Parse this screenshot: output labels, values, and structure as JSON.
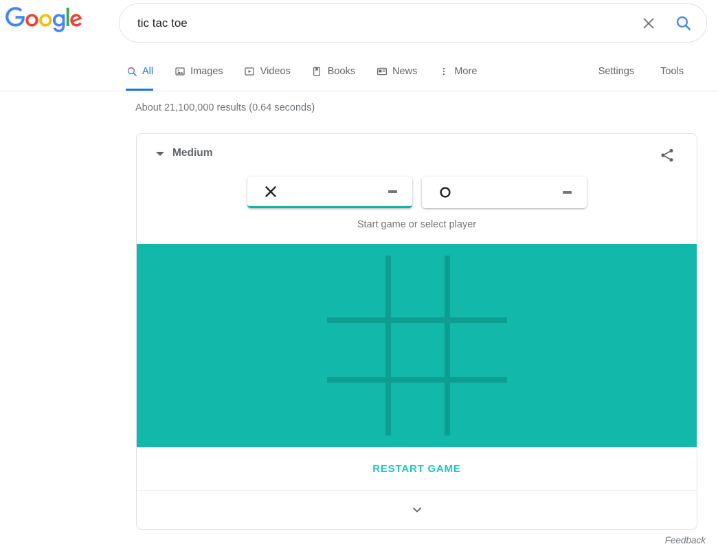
{
  "header": {
    "logo_alt": "Google",
    "logo_letters": [
      {
        "ch": "G",
        "color": "#4285f4"
      },
      {
        "ch": "o",
        "color": "#ea4335"
      },
      {
        "ch": "o",
        "color": "#fbbc05"
      },
      {
        "ch": "g",
        "color": "#4285f4"
      },
      {
        "ch": "l",
        "color": "#34a853"
      },
      {
        "ch": "e",
        "color": "#ea4335"
      }
    ],
    "search": {
      "value": "tic tac toe",
      "placeholder": "Search",
      "clear_icon": "close-icon",
      "search_icon": "search-icon"
    }
  },
  "nav": {
    "tabs": [
      {
        "label": "All",
        "icon": "search-icon",
        "active": true
      },
      {
        "label": "Images",
        "icon": "image-icon",
        "active": false
      },
      {
        "label": "Videos",
        "icon": "video-icon",
        "active": false
      },
      {
        "label": "Books",
        "icon": "book-icon",
        "active": false
      },
      {
        "label": "News",
        "icon": "news-icon",
        "active": false
      },
      {
        "label": "More",
        "icon": "more-vertical-icon",
        "active": false
      }
    ],
    "settings_label": "Settings",
    "tools_label": "Tools"
  },
  "results": {
    "count_text": "About 21,100,000 results (0.64 seconds)"
  },
  "game": {
    "difficulty": "Medium",
    "difficulty_caret_icon": "caret-down-icon",
    "share_icon": "share-icon",
    "players": [
      {
        "mark": "X",
        "icon": "x-mark-icon",
        "score": "-",
        "selected": true
      },
      {
        "mark": "O",
        "icon": "o-mark-icon",
        "score": "-",
        "selected": false
      }
    ],
    "status": "Start game or select player",
    "board": {
      "background_color": "#12b9aa",
      "line_color": "#0e9d91",
      "rows": 3,
      "cols": 3,
      "cells": [
        [
          "",
          "",
          ""
        ],
        [
          "",
          "",
          ""
        ],
        [
          "",
          "",
          ""
        ]
      ]
    },
    "restart_label": "RESTART GAME",
    "restart_color": "#1ec8bb",
    "expand_icon": "chevron-down-icon"
  },
  "footer": {
    "feedback_label": "Feedback"
  }
}
